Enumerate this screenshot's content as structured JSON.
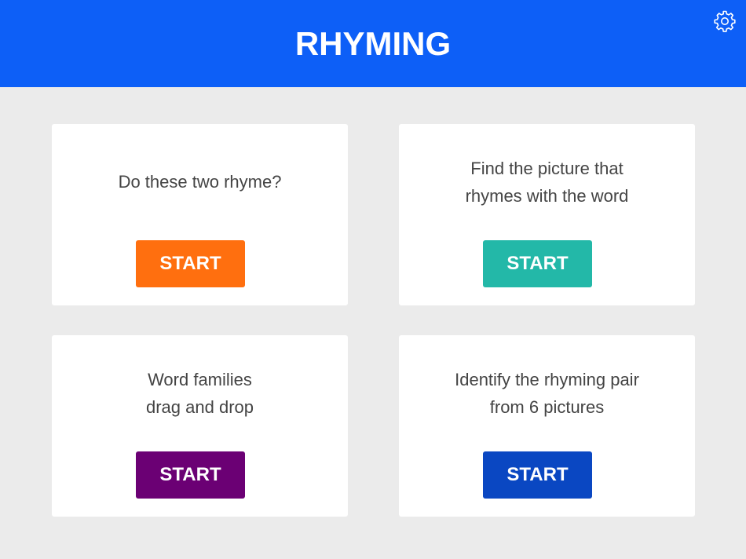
{
  "header": {
    "title": "RHYMING",
    "settings_icon": "gear-icon",
    "color": "#0d5ff7"
  },
  "cards": [
    {
      "lines": [
        "Do these two rhyme?"
      ],
      "button_label": "START",
      "button_color": "#ff6f0f"
    },
    {
      "lines": [
        "Find the picture that",
        "rhymes with the word"
      ],
      "button_label": "START",
      "button_color": "#23b8a8"
    },
    {
      "lines": [
        "Word families",
        "drag and drop"
      ],
      "button_label": "START",
      "button_color": "#6b0074"
    },
    {
      "lines": [
        "Identify the rhyming pair",
        "from 6 pictures"
      ],
      "button_label": "START",
      "button_color": "#0a47c2"
    }
  ]
}
